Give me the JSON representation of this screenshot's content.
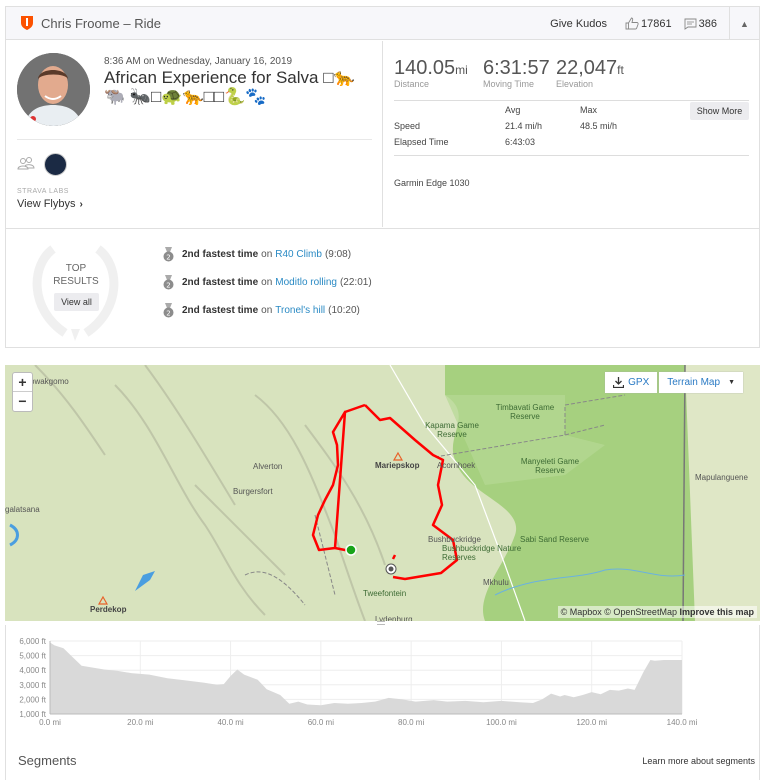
{
  "header": {
    "title": "Chris Froome – Ride",
    "give_kudos": "Give Kudos",
    "kudos_count": "17861",
    "comment_count": "386",
    "collapse_icon": "▲"
  },
  "activity": {
    "date": "8:36 AM on Wednesday, January 16, 2019",
    "title": "African Experience for Salva □🐆🐃 🐜□🐢🐆□□🐍🐾",
    "strava_labs": "STRAVA LABS",
    "view_flybys": "View Flybys",
    "flybys_chevron": "›"
  },
  "stats": {
    "distance": {
      "value": "140.05",
      "unit": "mi",
      "label": "Distance"
    },
    "moving_time": {
      "value": "6:31:57",
      "unit": "",
      "label": "Moving Time"
    },
    "elevation": {
      "value": "22,047",
      "unit": "ft",
      "label": "Elevation"
    },
    "table": {
      "headers": [
        "",
        "Avg",
        "Max"
      ],
      "rows": [
        {
          "label": "Speed",
          "avg": "21.4",
          "avg_unit": "mi/h",
          "max": "48.5",
          "max_unit": "mi/h"
        },
        {
          "label": "Elapsed Time",
          "avg": "6:43:03",
          "avg_unit": "",
          "max": "",
          "max_unit": ""
        }
      ]
    },
    "show_more": "Show More",
    "device": "Garmin Edge 1030"
  },
  "top_results": {
    "title_line1": "TOP",
    "title_line2": "RESULTS",
    "view_all": "View all",
    "items": [
      {
        "rank": "2",
        "achievement": "2nd fastest time",
        "on": "on",
        "segment": "R40 Climb",
        "time": "(9:08)"
      },
      {
        "rank": "2",
        "achievement": "2nd fastest time",
        "on": "on",
        "segment": "Moditlo rolling",
        "time": "(22:01)"
      },
      {
        "rank": "2",
        "achievement": "2nd fastest time",
        "on": "on",
        "segment": "Tronel's hill",
        "time": "(10:20)"
      }
    ]
  },
  "map": {
    "zoom_in": "+",
    "zoom_out": "−",
    "gpx_label": "GPX",
    "map_type": "Terrain Map",
    "attribution_mapbox": "© Mapbox",
    "attribution_osm": "© OpenStreetMap",
    "improve": "Improve this map",
    "labels": {
      "l1": "owakgomo",
      "l2": "Alverton",
      "l3": "Burgersfort",
      "l4": "galatsana",
      "l5": "Perdekop",
      "l6": "Mariepskop",
      "l7": "Acornhoek",
      "l8": "Kapama Game Reserve",
      "l9": "Timbavati Game Reserve",
      "l10": "Manyeleti Game Reserve",
      "l11": "Mapulanguene",
      "l12": "Bushbuckridge",
      "l13": "Bushbuckridge Nature Reserves",
      "l14": "Sabi Sand Reserve",
      "l15": "Mkhulu",
      "l16": "Tweefontein",
      "l17": "Lydenburg"
    },
    "colors": {
      "route": "#ff0000",
      "start": "#19a419",
      "reserve": "#a3cf7d",
      "terrain": "#d9e4bf"
    }
  },
  "chart_data": {
    "type": "area",
    "title": "",
    "xlabel": "",
    "ylabel": "",
    "x_ticks": [
      "0.0 mi",
      "20.0 mi",
      "40.0 mi",
      "60.0 mi",
      "80.0 mi",
      "100.0 mi",
      "120.0 mi",
      "140.0 mi"
    ],
    "y_ticks": [
      "1,000 ft",
      "2,000 ft",
      "3,000 ft",
      "4,000 ft",
      "5,000 ft",
      "6,000 ft"
    ],
    "xlim": [
      0,
      140
    ],
    "ylim": [
      1000,
      6000
    ],
    "grid": true,
    "x": [
      0,
      1,
      3,
      5,
      7,
      9,
      12,
      15,
      18,
      22,
      26,
      30,
      34,
      37,
      38.5,
      40,
      41.5,
      43,
      46,
      48,
      51,
      53,
      55,
      57,
      60,
      63,
      66,
      69,
      72,
      75,
      78,
      81,
      85,
      88,
      92,
      96,
      100,
      104,
      107,
      109,
      111,
      113,
      114,
      116,
      118,
      120,
      122,
      124,
      126,
      128,
      129.5,
      131.5,
      133,
      134,
      136,
      138,
      140
    ],
    "y": [
      5900,
      5700,
      5500,
      4900,
      4300,
      4200,
      4050,
      3950,
      3800,
      3700,
      3450,
      3300,
      3150,
      3000,
      3050,
      3600,
      4050,
      3700,
      3350,
      2700,
      2300,
      1700,
      1850,
      1650,
      1600,
      1750,
      1700,
      1750,
      1850,
      2100,
      2000,
      1850,
      1950,
      1850,
      1900,
      1800,
      1900,
      1800,
      1750,
      2000,
      2400,
      2200,
      2300,
      2150,
      2300,
      2500,
      2350,
      2650,
      2600,
      2750,
      2650,
      3900,
      4700,
      4650,
      4700,
      4700,
      4700
    ],
    "fill_color": "#d9d9d9"
  },
  "segments": {
    "title": "Segments",
    "learn_more": "Learn more about segments"
  }
}
